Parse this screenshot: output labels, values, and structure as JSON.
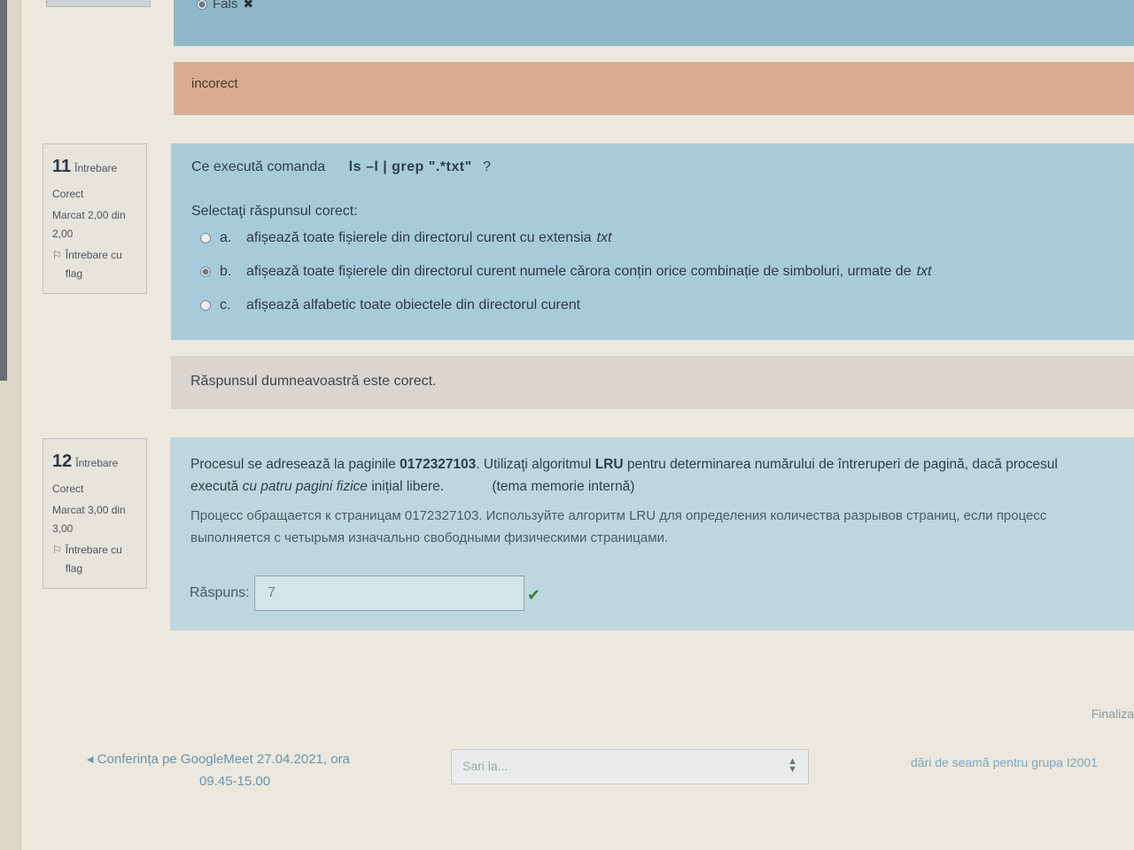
{
  "q10": {
    "option_label": "Fals",
    "option_mark": "✖",
    "feedback": "incorect"
  },
  "q11": {
    "number": "11",
    "word": "Întrebare",
    "status": "Corect",
    "mark": "Marcat 2,00 din 2,00",
    "flag_label": "Întrebare cu flag",
    "question_prefix": "Ce execută comanda",
    "command": "ls –l | grep \".*txt\"",
    "question_suffix": "?",
    "select_prompt": "Selectaţi răspunsul corect:",
    "options": [
      {
        "letter": "a.",
        "text": "afișează toate fișierele din directorul curent cu extensia",
        "ext": "txt"
      },
      {
        "letter": "b.",
        "text": "afișează toate fișierele din directorul curent numele cărora conțin orice combinație de simboluri, urmate de",
        "ext": "txt"
      },
      {
        "letter": "c.",
        "text": "afișează alfabetic toate obiectele din directorul curent",
        "ext": ""
      }
    ],
    "feedback": "Răspunsul dumneavoastră este corect."
  },
  "q12": {
    "number": "12",
    "word": "Întrebare",
    "status": "Corect",
    "mark": "Marcat 3,00 din 3,00",
    "flag_label": "Întrebare cu flag",
    "ro_1": "Procesul se adresează la paginile ",
    "ro_pages": "0172327103",
    "ro_2": ". Utilizaţi algoritmul ",
    "ro_alg": "LRU",
    "ro_3": " pentru determinarea numărului de întreruperi de pagină, dacă procesul",
    "ro_4": "execută ",
    "ro_italic": "cu patru pagini fizice",
    "ro_5": " inițial libere.",
    "ro_topic": "(tema memorie internă)",
    "ru_1": "Процесс обращается к страницам 0172327103. Используйте алгоритм LRU для определения количества разрывов страниц, если процесс",
    "ru_2": "выполняется с четырьмя изначально свободными физическими страницами.",
    "answer_label": "Răspuns:",
    "answer_value": "7"
  },
  "footer": {
    "finalize": "Finaliza",
    "prev_line1": "Conferința pe GoogleMeet 27.04.2021, ora",
    "prev_line2": "09.45-15.00",
    "jump_placeholder": "Sari la...",
    "next_link": "dări de seamă pentru grupa I2001"
  },
  "colors": {
    "info_bg": "#a8cbdc",
    "incorrect_bg": "#d8ab92",
    "correct_check": "#2f8a3c"
  }
}
